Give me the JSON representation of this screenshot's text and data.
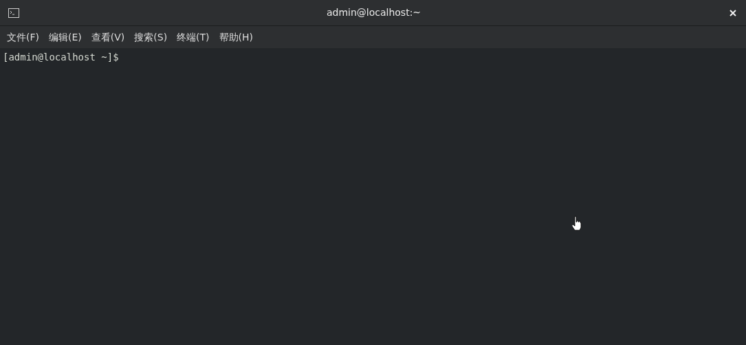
{
  "window": {
    "title": "admin@localhost:~"
  },
  "menu": [
    "文件(F)",
    "编辑(E)",
    "查看(V)",
    "搜索(S)",
    "终端(T)",
    "帮助(H)"
  ],
  "terminal": {
    "prompt": "[admin@localhost ~]$"
  }
}
